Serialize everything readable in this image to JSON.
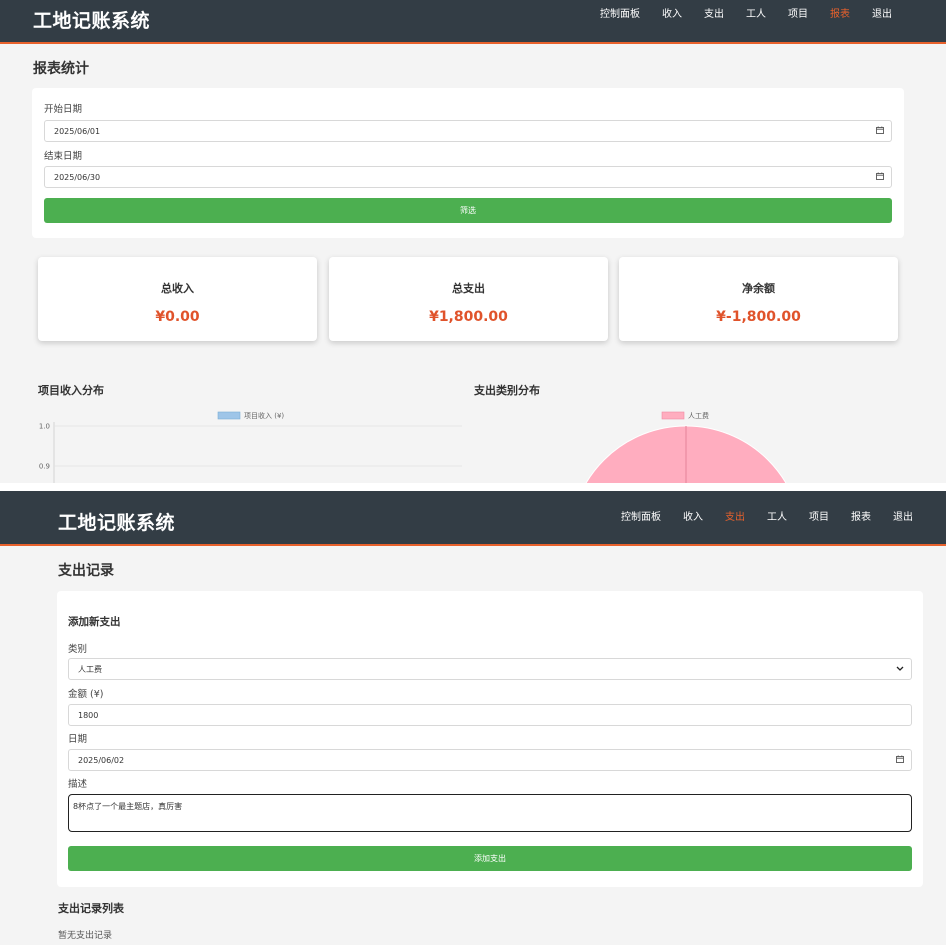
{
  "app": {
    "title": "工地记账系统"
  },
  "nav": {
    "items": [
      {
        "label": "控制面板"
      },
      {
        "label": "收入"
      },
      {
        "label": "支出"
      },
      {
        "label": "工人"
      },
      {
        "label": "项目"
      },
      {
        "label": "报表"
      },
      {
        "label": "退出"
      }
    ],
    "reports_active": "报表",
    "expense_active": "支出",
    "accent_color": "#e8612c"
  },
  "reports": {
    "title": "报表统计",
    "start_date_label": "开始日期",
    "start_date_value": "2025/06/01",
    "end_date_label": "结束日期",
    "end_date_value": "2025/06/30",
    "calendar_icon": "calendar-icon",
    "filter_button": "筛选",
    "stats": [
      {
        "title": "总收入",
        "value": "¥0.00"
      },
      {
        "title": "总支出",
        "value": "¥1,800.00"
      },
      {
        "title": "净余额",
        "value": "¥-1,800.00"
      }
    ],
    "income_chart_title": "项目收入分布",
    "expense_chart_title": "支出类别分布"
  },
  "chart_data": [
    {
      "type": "bar",
      "title": "项目收入分布",
      "series": [
        {
          "name": "项目收入 (¥)",
          "values": []
        }
      ],
      "y_ticks": [
        "1.0",
        "0.9"
      ],
      "ylim": [
        0.9,
        1.0
      ],
      "legend": "top-center",
      "grid": true,
      "color": "#9ec5e8"
    },
    {
      "type": "pie",
      "title": "支出类别分布",
      "categories": [
        "人工费"
      ],
      "values": [
        1800
      ],
      "legend": "top-center",
      "color": "#ffadbf"
    }
  ],
  "expense": {
    "title": "支出记录",
    "form_title": "添加新支出",
    "category_label": "类别",
    "category_value": "人工费",
    "amount_label": "金额 (¥)",
    "amount_value": "1800",
    "date_label": "日期",
    "date_value": "2025/06/02",
    "description_label": "描述",
    "description_value": "8杯点了一个最主题店，真厉害",
    "submit_button": "添加支出",
    "list_title": "支出记录列表",
    "empty_text": "暂无支出记录"
  }
}
